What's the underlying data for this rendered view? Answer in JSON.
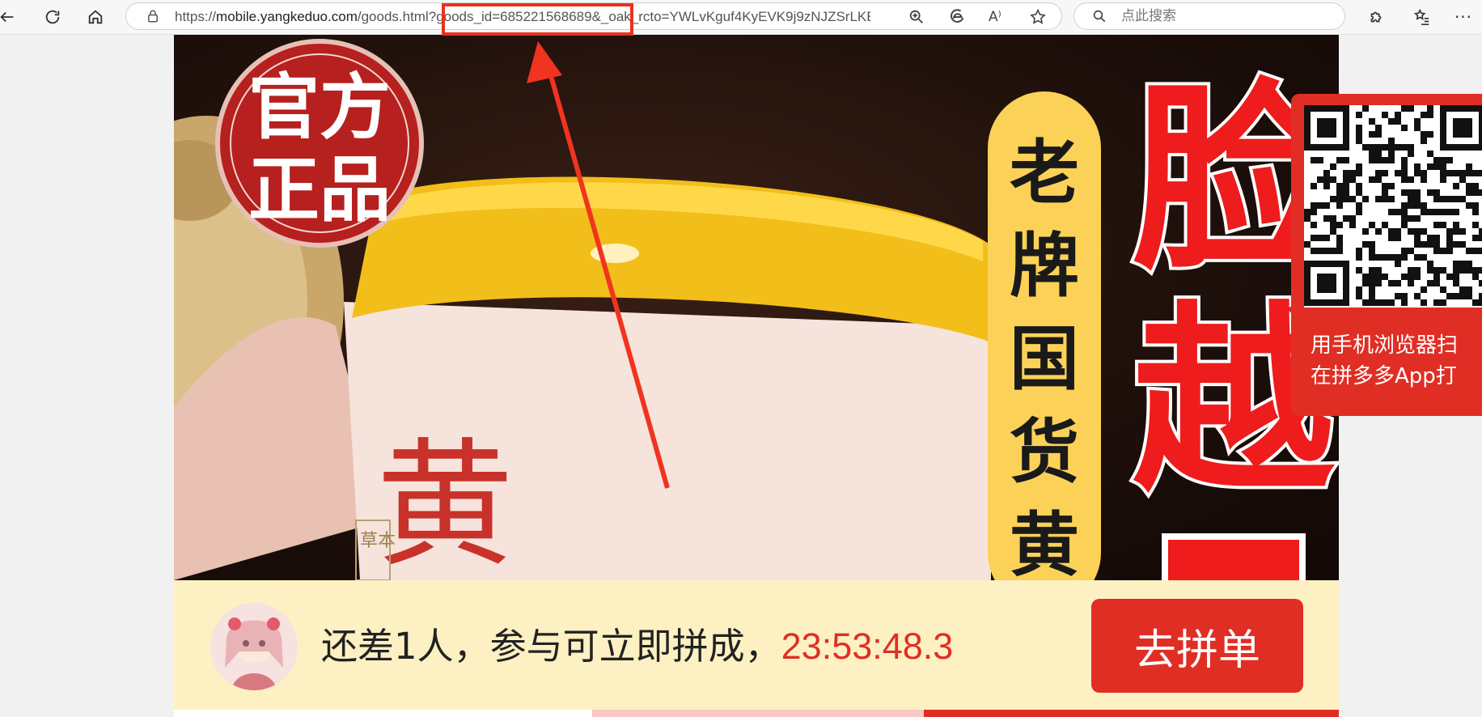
{
  "browser": {
    "url_prefix": "https://",
    "url_host": "mobile.yangkeduo.com",
    "url_rest": "/goods.html?goods_id=685221568689&_oak_rcto=YWLvKguf4KyEVK9j9zNJZSrLKE...",
    "search_placeholder": "点此搜索",
    "read_aloud_label": "A⁾"
  },
  "product_image": {
    "badge_line1": "官方",
    "badge_line2": "正品",
    "pill_text": [
      "老",
      "牌",
      "国",
      "货",
      "黄"
    ],
    "big_text": [
      "脸",
      "越"
    ],
    "jar_text": "黄",
    "jar_small_text": "草本"
  },
  "qr": {
    "line1": "用手机浏览器扫",
    "line2": "在拼多多App打"
  },
  "group_buy": {
    "message": "还差1人，参与可立即拼成，",
    "countdown": "23:53:48.3",
    "button_label": "去拼单"
  },
  "colors": {
    "accent_red": "#e02e24",
    "bar_bg": "#fdf0c2",
    "highlight": "#e8321e"
  }
}
